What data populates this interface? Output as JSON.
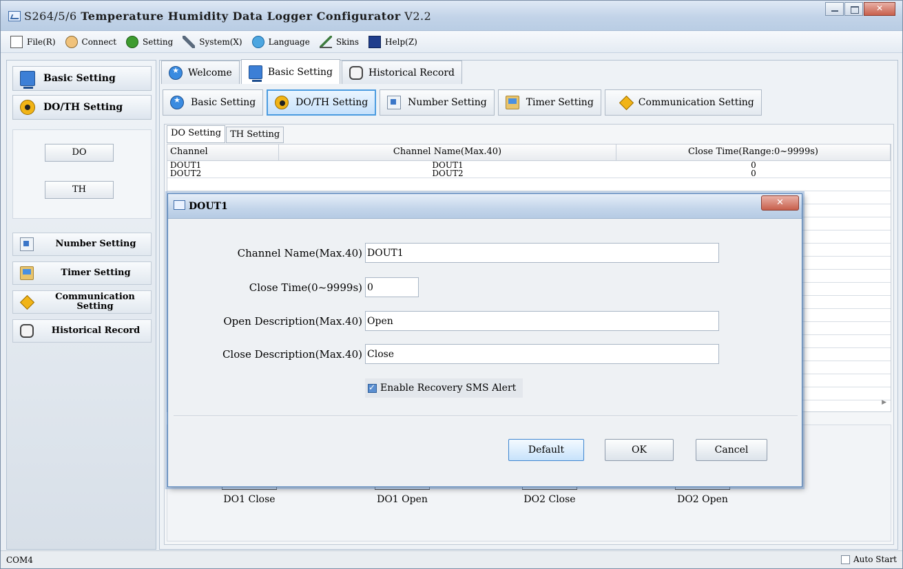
{
  "window": {
    "title_prefix": "S264/5/6 ",
    "title_main": "Temperature Humidity Data Logger Configurator",
    "title_version": " V2.2"
  },
  "menu": [
    {
      "label": "File(R)",
      "icon": "file-icon"
    },
    {
      "label": "Connect",
      "icon": "connect-icon"
    },
    {
      "label": "Setting",
      "icon": "setting-icon"
    },
    {
      "label": "System(X)",
      "icon": "system-icon"
    },
    {
      "label": "Language",
      "icon": "language-icon"
    },
    {
      "label": "Skins",
      "icon": "skins-icon"
    },
    {
      "label": "Help(Z)",
      "icon": "help-icon"
    }
  ],
  "sidebar": {
    "basic_setting": "Basic Setting",
    "do_th_setting": "DO/TH Setting",
    "do_button": "DO",
    "th_button": "TH",
    "number_setting": "Number Setting",
    "timer_setting": "Timer Setting",
    "communication_setting": "Communication Setting",
    "historical_record": "Historical Record"
  },
  "main_tabs": [
    "Welcome",
    "Basic Setting",
    "Historical Record"
  ],
  "sub_tabs": [
    "Basic Setting",
    "DO/TH Setting",
    "Number Setting",
    "Timer Setting",
    "Communication Setting"
  ],
  "inner_tabs": [
    "DO Setting",
    "TH Setting"
  ],
  "table": {
    "headers": [
      "Channel",
      "Channel Name(Max.40)",
      "Close Time(Range:0~9999s)"
    ],
    "rows": [
      [
        "DOUT1",
        "DOUT1",
        "0"
      ],
      [
        "DOUT2",
        "DOUT2",
        "0"
      ]
    ]
  },
  "do_labels": [
    "DO1 Close",
    "DO1 Open",
    "DO2 Close",
    "DO2 Open"
  ],
  "status": {
    "port": "COM4",
    "auto_start": "Auto Start"
  },
  "dialog": {
    "title": "DOUT1",
    "channel_name_label": "Channel Name(Max.40)",
    "channel_name_value": "DOUT1",
    "close_time_label": "Close Time(0~9999s)",
    "close_time_value": "0",
    "open_desc_label": "Open Description(Max.40)",
    "open_desc_value": "Open",
    "close_desc_label": "Close Description(Max.40)",
    "close_desc_value": "Close",
    "recovery_sms_label": "Enable Recovery SMS Alert",
    "default_button": "Default",
    "ok_button": "OK",
    "cancel_button": "Cancel"
  }
}
